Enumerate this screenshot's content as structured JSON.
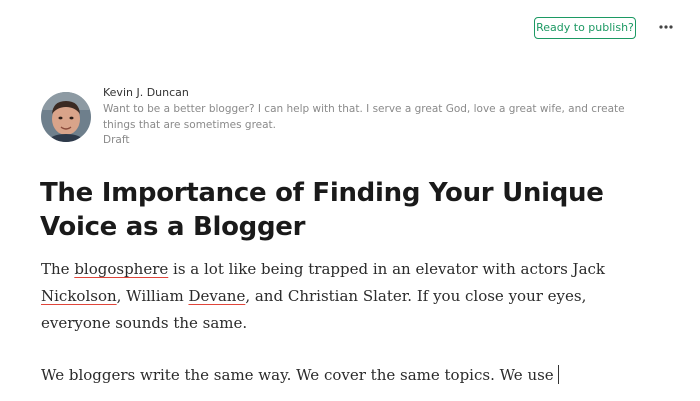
{
  "header": {
    "publish_label": "Ready to publish?",
    "more_icon": "ellipsis-icon",
    "accent_color": "#1c9963"
  },
  "author": {
    "name": "Kevin J. Duncan",
    "bio_line1": "Want to be a better blogger? I can help with that. I serve a great God, love a great wife, and create",
    "bio_line2": "things that are sometimes great.",
    "status": "Draft"
  },
  "post": {
    "title_line1": "The Importance of Finding Your Unique",
    "title_line2": "Voice as a Blogger",
    "p1": {
      "s1": "The ",
      "w1": "blogosphere",
      "s2": " is a lot like being trapped in an elevator with actors Jack",
      "w2": "Nickolson",
      "s3": ", William ",
      "w3": "Devane",
      "s4": ", and Christian Slater. If you close your eyes,",
      "s5": "everyone sounds the same."
    },
    "p2": "We bloggers write the same way. We cover the same topics. We use"
  }
}
